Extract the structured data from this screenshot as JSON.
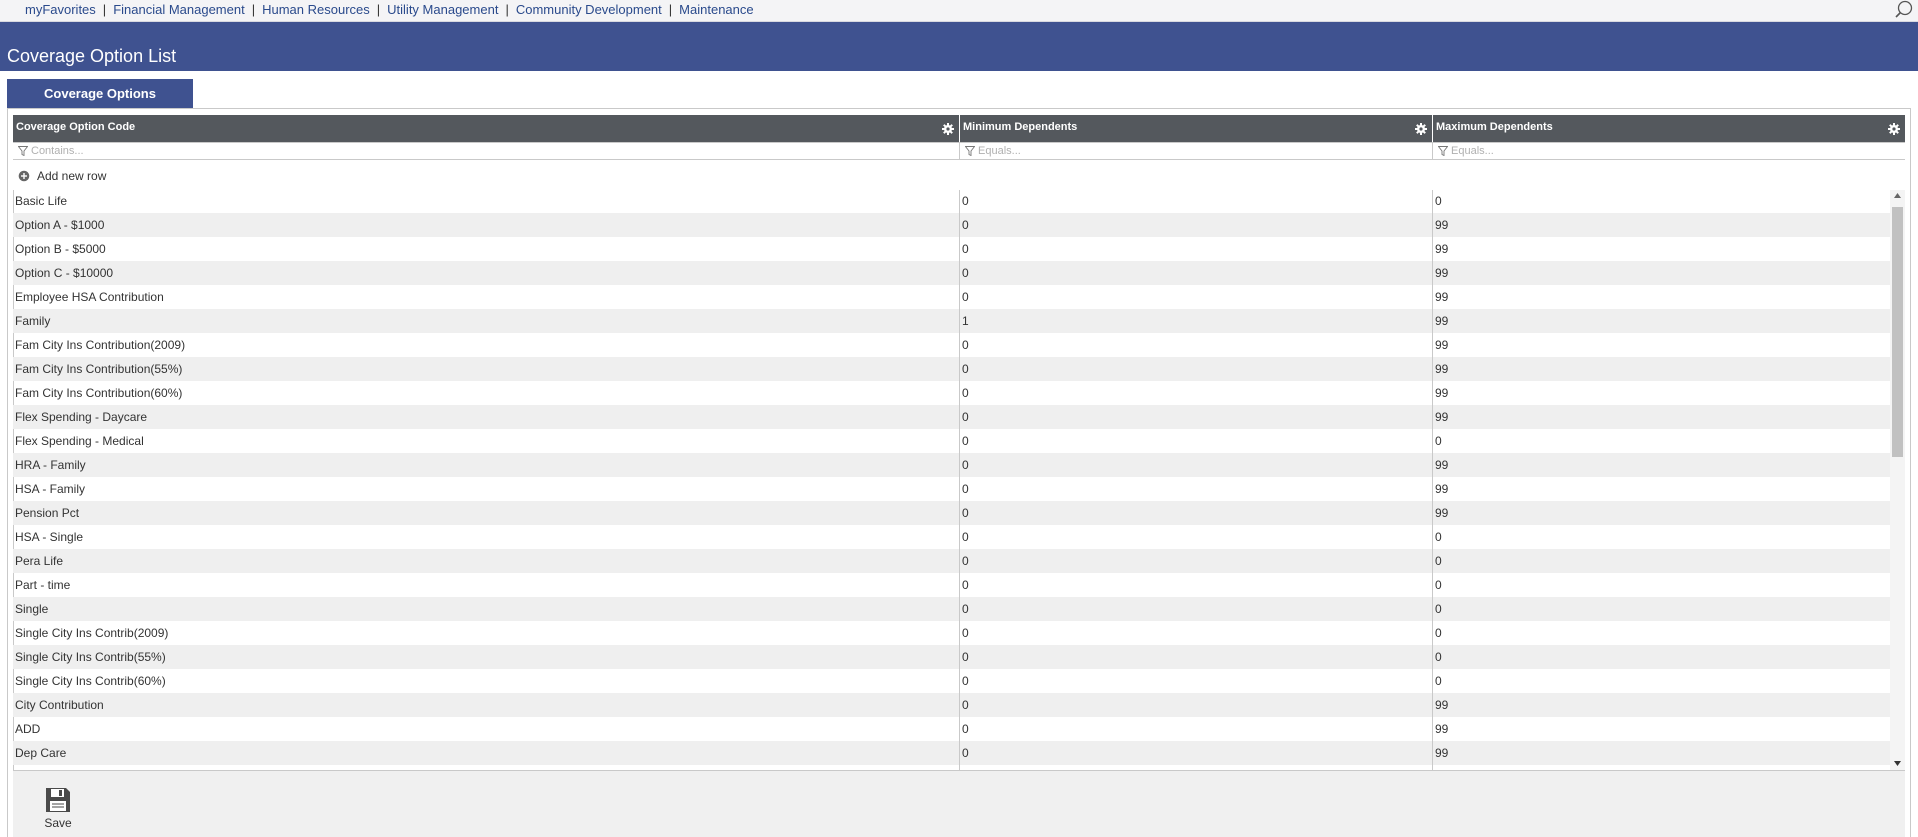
{
  "nav": {
    "items": [
      "myFavorites",
      "Financial Management",
      "Human Resources",
      "Utility Management",
      "Community Development",
      "Maintenance"
    ],
    "separator": "|",
    "search_icon": "magnifier-icon"
  },
  "page": {
    "title": "Coverage Option List"
  },
  "tabs": [
    {
      "label": "Coverage Options",
      "active": true
    }
  ],
  "grid": {
    "columns": [
      {
        "label": "Coverage Option Code",
        "filter_placeholder": "Contains..."
      },
      {
        "label": "Minimum Dependents",
        "filter_placeholder": "Equals..."
      },
      {
        "label": "Maximum Dependents",
        "filter_placeholder": "Equals..."
      }
    ],
    "add_row_label": "Add new row",
    "rows": [
      [
        "Basic Life",
        "0",
        "0"
      ],
      [
        "Option A - $1000",
        "0",
        "99"
      ],
      [
        "Option B - $5000",
        "0",
        "99"
      ],
      [
        "Option C - $10000",
        "0",
        "99"
      ],
      [
        "Employee HSA Contribution",
        "0",
        "99"
      ],
      [
        "Family",
        "1",
        "99"
      ],
      [
        "Fam City Ins Contribution(2009)",
        "0",
        "99"
      ],
      [
        "Fam City Ins Contribution(55%)",
        "0",
        "99"
      ],
      [
        "Fam City Ins Contribution(60%)",
        "0",
        "99"
      ],
      [
        "Flex Spending - Daycare",
        "0",
        "99"
      ],
      [
        "Flex Spending - Medical",
        "0",
        "0"
      ],
      [
        "HRA - Family",
        "0",
        "99"
      ],
      [
        "HSA - Family",
        "0",
        "99"
      ],
      [
        "Pension Pct",
        "0",
        "99"
      ],
      [
        "HSA - Single",
        "0",
        "0"
      ],
      [
        "Pera Life",
        "0",
        "0"
      ],
      [
        "Part - time",
        "0",
        "0"
      ],
      [
        "Single",
        "0",
        "0"
      ],
      [
        "Single City Ins Contrib(2009)",
        "0",
        "0"
      ],
      [
        "Single City Ins Contrib(55%)",
        "0",
        "0"
      ],
      [
        "Single City Ins Contrib(60%)",
        "0",
        "0"
      ],
      [
        "City Contribution",
        "0",
        "99"
      ],
      [
        "ADD",
        "0",
        "99"
      ],
      [
        "Dep Care",
        "0",
        "99"
      ]
    ]
  },
  "footer": {
    "save_label": "Save"
  },
  "colors": {
    "brand_blue": "#3f5290",
    "header_gray": "#54585d",
    "nav_link": "#2a4a8c",
    "row_alt": "#efefef"
  }
}
